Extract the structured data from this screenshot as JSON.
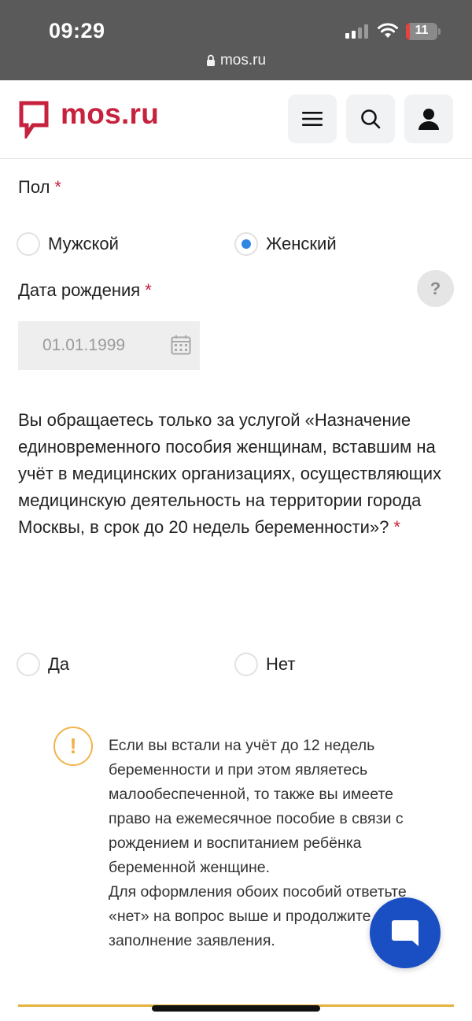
{
  "status_bar": {
    "time": "09:29",
    "url": "mos.ru",
    "battery": "11"
  },
  "header": {
    "logo_text": "mos.ru",
    "brand_color": "#c6213d"
  },
  "form": {
    "gender": {
      "label": "Пол",
      "required_mark": "*",
      "options": [
        {
          "label": "Мужской",
          "checked": false
        },
        {
          "label": "Женский",
          "checked": true
        }
      ]
    },
    "birth_date": {
      "label": "Дата рождения",
      "required_mark": "*",
      "value": "01.01.1999",
      "help": "?"
    },
    "service_question": {
      "text": "Вы обращаетесь только за услугой «Назначение единовременного пособия женщинам, вставшим на учёт в медицинских организациях, осуществляющих медицинскую деятельность на территории города Москвы, в срок до 20 недель беременности»?",
      "required_mark": "*",
      "options": [
        {
          "label": "Да",
          "checked": false
        },
        {
          "label": "Нет",
          "checked": false
        }
      ]
    }
  },
  "info": {
    "icon": "!",
    "paragraph1": "Если вы встали на учёт до 12 недель беременности и при этом являетесь малообеспеченной, то также вы имеете право на ежемесячное пособие в связи с рождением и воспитанием ребёнка беременной женщине.",
    "paragraph2": "Для оформления обоих пособий ответьте «нет» на вопрос выше и продолжите заполнение заявления."
  }
}
